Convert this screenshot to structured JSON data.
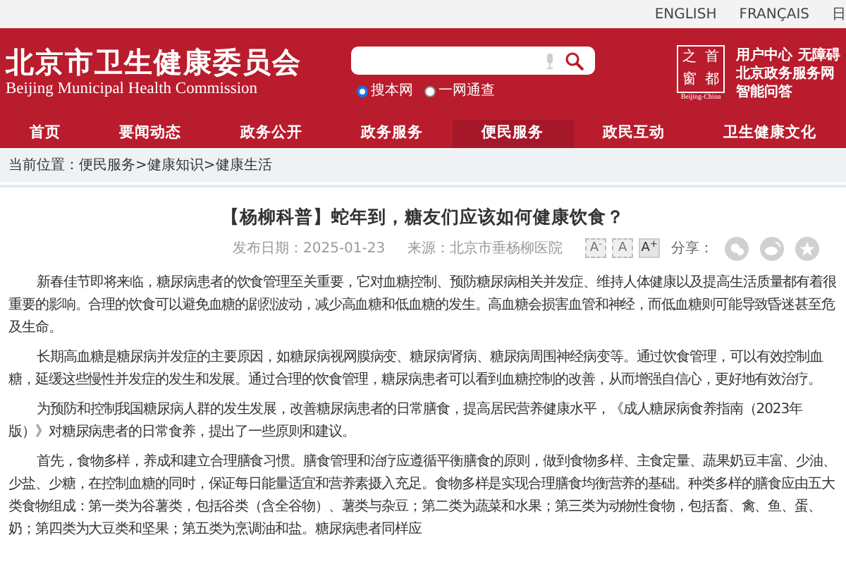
{
  "top_links": [
    "ENGLISH",
    "FRANÇAIS",
    "日"
  ],
  "site": {
    "title": "北京市卫生健康委员会",
    "subtitle": "Beijing Municipal Health Commission"
  },
  "search": {
    "options": [
      {
        "label": "搜本网",
        "selected": true
      },
      {
        "label": "一网通查",
        "selected": false
      }
    ]
  },
  "emblem": {
    "chars": [
      "之",
      "首",
      "窗",
      "都"
    ],
    "caption": "Beijing-China"
  },
  "user_links": [
    [
      "用户中心",
      "无障碍"
    ],
    [
      "北京政务服务网"
    ],
    [
      "智能问答"
    ]
  ],
  "nav": [
    {
      "label": "首页",
      "selected": false
    },
    {
      "label": "要闻动态",
      "selected": false
    },
    {
      "label": "政务公开",
      "selected": false
    },
    {
      "label": "政务服务",
      "selected": false
    },
    {
      "label": "便民服务",
      "selected": true
    },
    {
      "label": "政民互动",
      "selected": false
    },
    {
      "label": "卫生健康文化",
      "selected": false
    }
  ],
  "breadcrumb": {
    "label": "当前位置：",
    "path": "便民服务>健康知识>健康生活"
  },
  "article": {
    "title": "【杨柳科普】蛇年到，糖友们应该如何健康饮食？",
    "date": "发布日期：2025-01-23",
    "source": "来源：北京市垂杨柳医院",
    "font_sizes": [
      {
        "label": "A$^{-}$",
        "selected": false
      },
      {
        "label": "A",
        "selected": false
      },
      {
        "label": "A$^{+}$",
        "selected": true
      }
    ],
    "share_label": "分享：",
    "share": [
      {
        "kind": "wechat"
      },
      {
        "kind": "weibo"
      },
      {
        "kind": "favorite"
      }
    ],
    "paragraphs": [
      "新春佳节即将来临，糖尿病患者的饮食管理至关重要，它对血糖控制、预防糖尿病相关并发症、维持人体健康以及提高生活质量都有着很重要的影响。合理的饮食可以避免血糖的剧烈波动，减少高血糖和低血糖的发生。高血糖会损害血管和神经，而低血糖则可能导致昏迷甚至危及生命。",
      "长期高血糖是糖尿病并发症的主要原因，如糖尿病视网膜病变、糖尿病肾病、糖尿病周围神经病变等。通过饮食管理，可以有效控制血糖，延缓这些慢性并发症的发生和发展。通过合理的饮食管理，糖尿病患者可以看到血糖控制的改善，从而增强自信心，更好地有效治疗。",
      "为预防和控制我国糖尿病人群的发生发展，改善糖尿病患者的日常膳食，提高居民营养健康水平，《成人糖尿病食养指南（2023年版）》对糖尿病患者的日常食养，提出了一些原则和建议。",
      "首先，食物多样，养成和建立合理膳食习惯。膳食管理和治疗应遵循平衡膳食的原则，做到食物多样、主食定量、蔬果奶豆丰富、少油、少盐、少糖，在控制血糖的同时，保证每日能量适宜和营养素摄入充足。食物多样是实现合理膳食均衡营养的基础。种类多样的膳食应由五大类食物组成：第一类为谷薯类，包括谷类（含全谷物）、薯类与杂豆；第二类为蔬菜和水果；第三类为动物性食物，包括畜、禽、鱼、蛋、奶；第四类为大豆类和坚果；第五类为烹调油和盐。糖尿病患者同样应"
    ]
  }
}
